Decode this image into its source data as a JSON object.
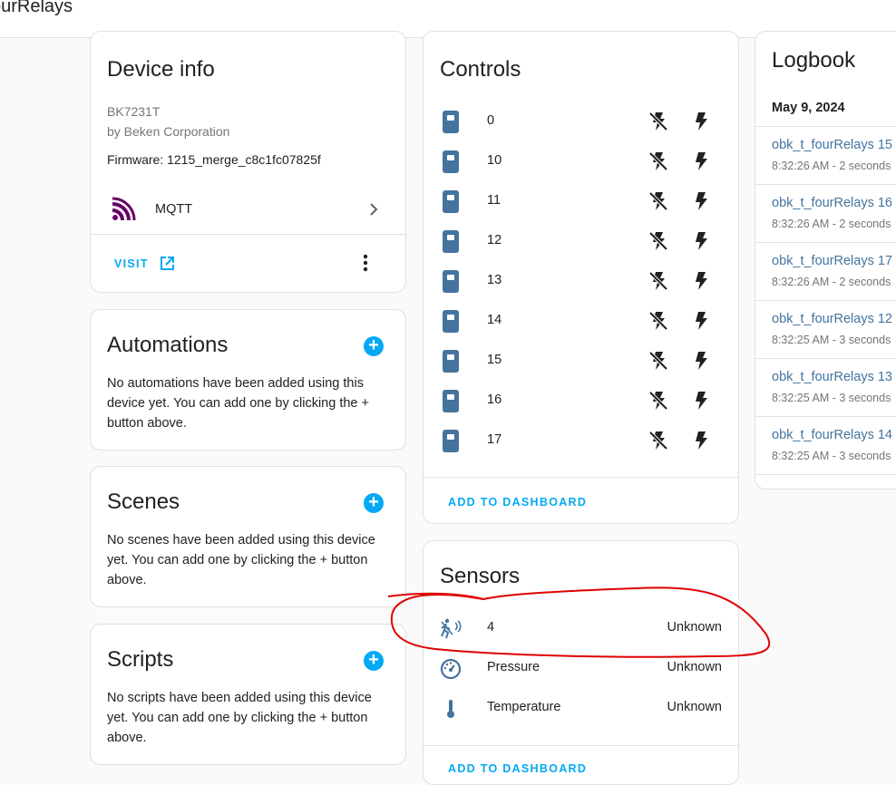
{
  "header": {
    "title": "ourRelays"
  },
  "device_info": {
    "title": "Device info",
    "model": "BK7231T",
    "manufacturer": "by Beken Corporation",
    "firmware": "Firmware: 1215_merge_c8c1fc07825f",
    "integration": "MQTT",
    "visit_label": "VISIT"
  },
  "automations": {
    "title": "Automations",
    "text": "No automations have been added using this device yet. You can add one by clicking the + button above."
  },
  "scenes": {
    "title": "Scenes",
    "text": "No scenes have been added using this device yet. You can add one by clicking the + button above."
  },
  "scripts": {
    "title": "Scripts",
    "text": "No scripts have been added using this device yet. You can add one by clicking the + button above."
  },
  "controls": {
    "title": "Controls",
    "items": [
      "0",
      "10",
      "11",
      "12",
      "13",
      "14",
      "15",
      "16",
      "17"
    ],
    "add_label": "ADD TO DASHBOARD"
  },
  "sensors": {
    "title": "Sensors",
    "items": [
      {
        "label": "4",
        "value": "Unknown",
        "icon": "motion-sensor-icon"
      },
      {
        "label": "Pressure",
        "value": "Unknown",
        "icon": "gauge-icon"
      },
      {
        "label": "Temperature",
        "value": "Unknown",
        "icon": "thermometer-icon"
      }
    ],
    "add_label": "ADD TO DASHBOARD"
  },
  "logbook": {
    "title": "Logbook",
    "date": "May 9, 2024",
    "entries": [
      {
        "name": "obk_t_fourRelays 15",
        "time": "8:32:26 AM - 2 seconds"
      },
      {
        "name": "obk_t_fourRelays 16",
        "time": "8:32:26 AM - 2 seconds"
      },
      {
        "name": "obk_t_fourRelays 17",
        "time": "8:32:26 AM - 2 seconds"
      },
      {
        "name": "obk_t_fourRelays 12",
        "time": "8:32:25 AM - 3 seconds"
      },
      {
        "name": "obk_t_fourRelays 13",
        "time": "8:32:25 AM - 3 seconds"
      },
      {
        "name": "obk_t_fourRelays 14",
        "time": "8:32:25 AM - 3 seconds"
      }
    ]
  },
  "colors": {
    "accent": "#03a9f4",
    "switch": "#44739e",
    "annotation": "#e00000"
  }
}
